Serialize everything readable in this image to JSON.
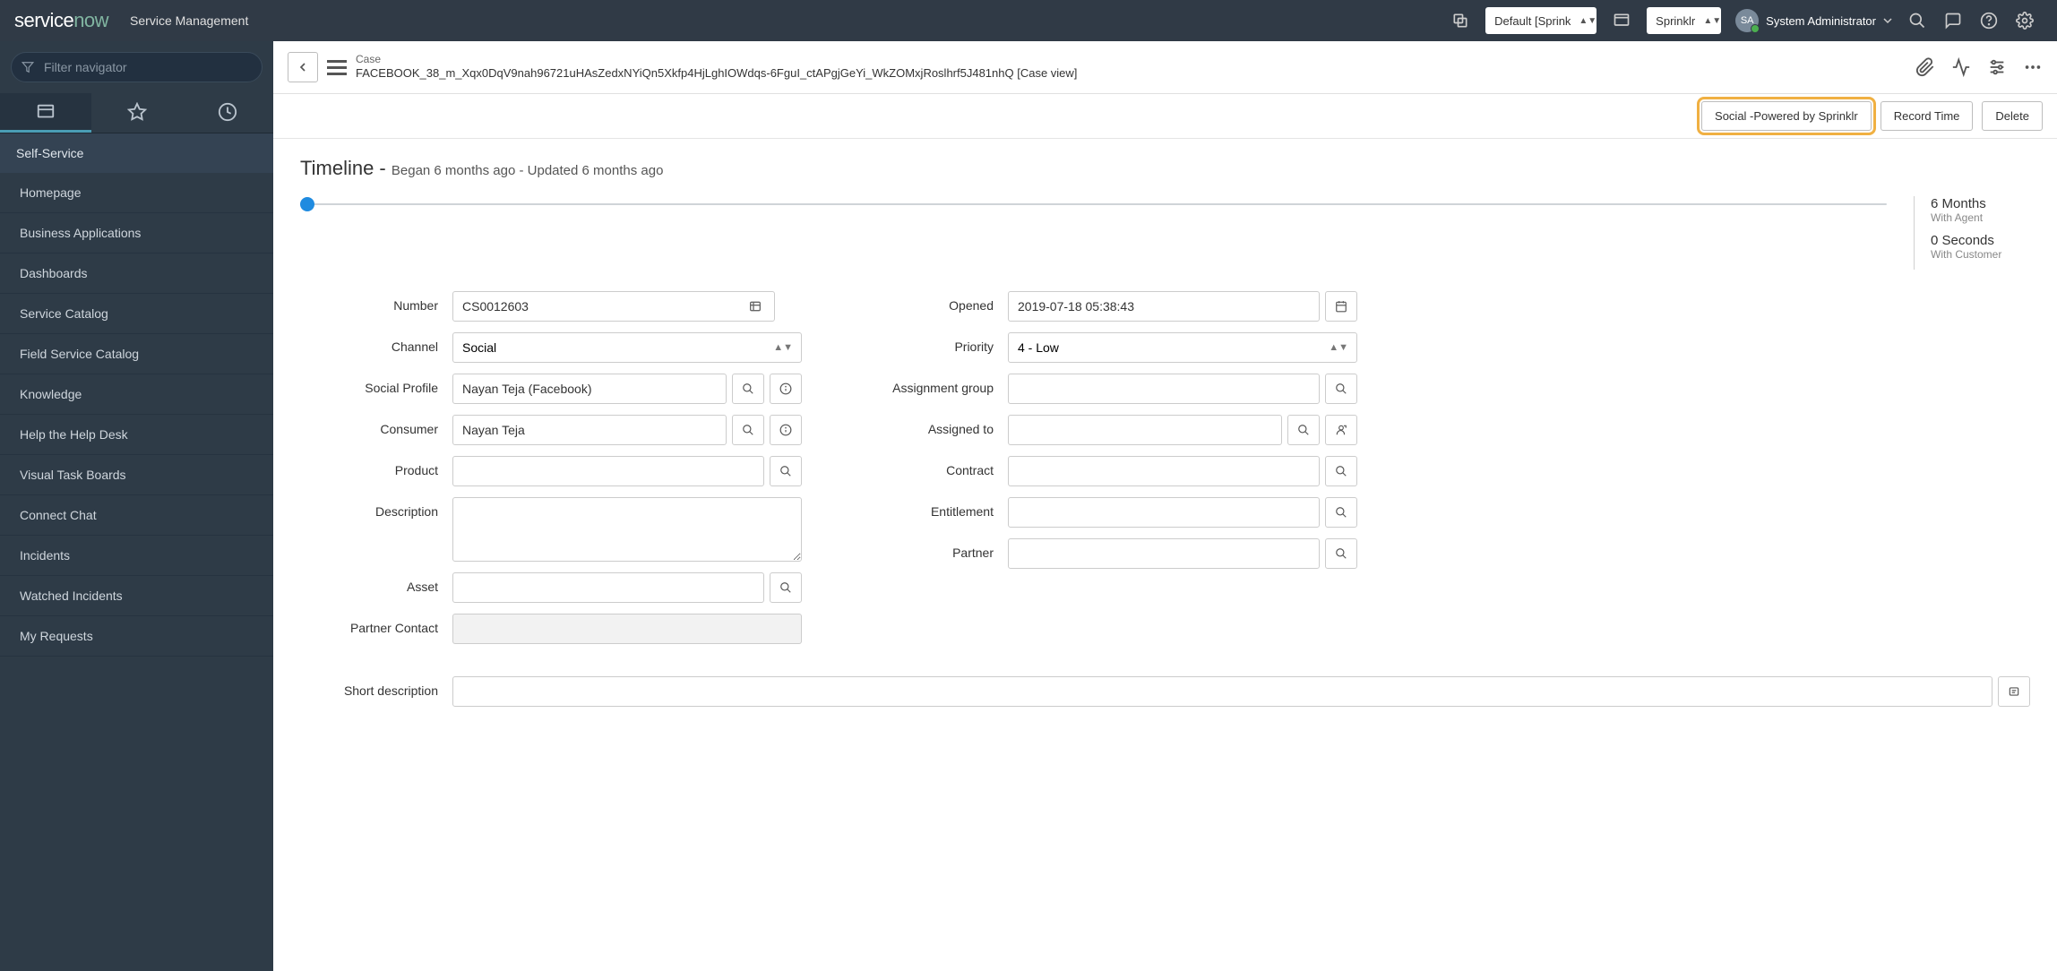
{
  "header": {
    "app_name": "Service Management",
    "picker1": "Default [Sprink",
    "picker2": "Sprinklr",
    "user_initials": "SA",
    "user_name": "System Administrator"
  },
  "nav": {
    "filter_placeholder": "Filter navigator",
    "section_title": "Self-Service",
    "items": [
      "Homepage",
      "Business Applications",
      "Dashboards",
      "Service Catalog",
      "Field Service Catalog",
      "Knowledge",
      "Help the Help Desk",
      "Visual Task Boards",
      "Connect Chat",
      "Incidents",
      "Watched Incidents",
      "My Requests"
    ]
  },
  "record": {
    "label": "Case",
    "identifier": "FACEBOOK_38_m_Xqx0DqV9nah96721uHAsZedxNYiQn5Xkfp4HjLghIOWdqs-6FguI_ctAPgjGeYi_WkZOMxjRoslhrf5J481nhQ [Case view]"
  },
  "actions": {
    "social": "Social -Powered by Sprinklr",
    "record_time": "Record Time",
    "delete": "Delete"
  },
  "timeline": {
    "title": "Timeline - ",
    "subtitle": "Began 6 months ago - Updated 6 months ago",
    "agent_value": "6 Months",
    "agent_label": "With Agent",
    "customer_value": "0 Seconds",
    "customer_label": "With Customer"
  },
  "form": {
    "labels": {
      "number": "Number",
      "channel": "Channel",
      "social_profile": "Social Profile",
      "consumer": "Consumer",
      "product": "Product",
      "description": "Description",
      "asset": "Asset",
      "partner_contact": "Partner Contact",
      "short_description": "Short description",
      "opened": "Opened",
      "priority": "Priority",
      "assignment_group": "Assignment group",
      "assigned_to": "Assigned to",
      "contract": "Contract",
      "entitlement": "Entitlement",
      "partner": "Partner"
    },
    "values": {
      "number": "CS0012603",
      "channel": "Social",
      "social_profile": "Nayan Teja (Facebook)",
      "consumer": "Nayan Teja",
      "product": "",
      "description": "",
      "asset": "",
      "partner_contact": "",
      "short_description": "",
      "opened": "2019-07-18 05:38:43",
      "priority": "4 - Low",
      "assignment_group": "",
      "assigned_to": "",
      "contract": "",
      "entitlement": "",
      "partner": ""
    }
  }
}
